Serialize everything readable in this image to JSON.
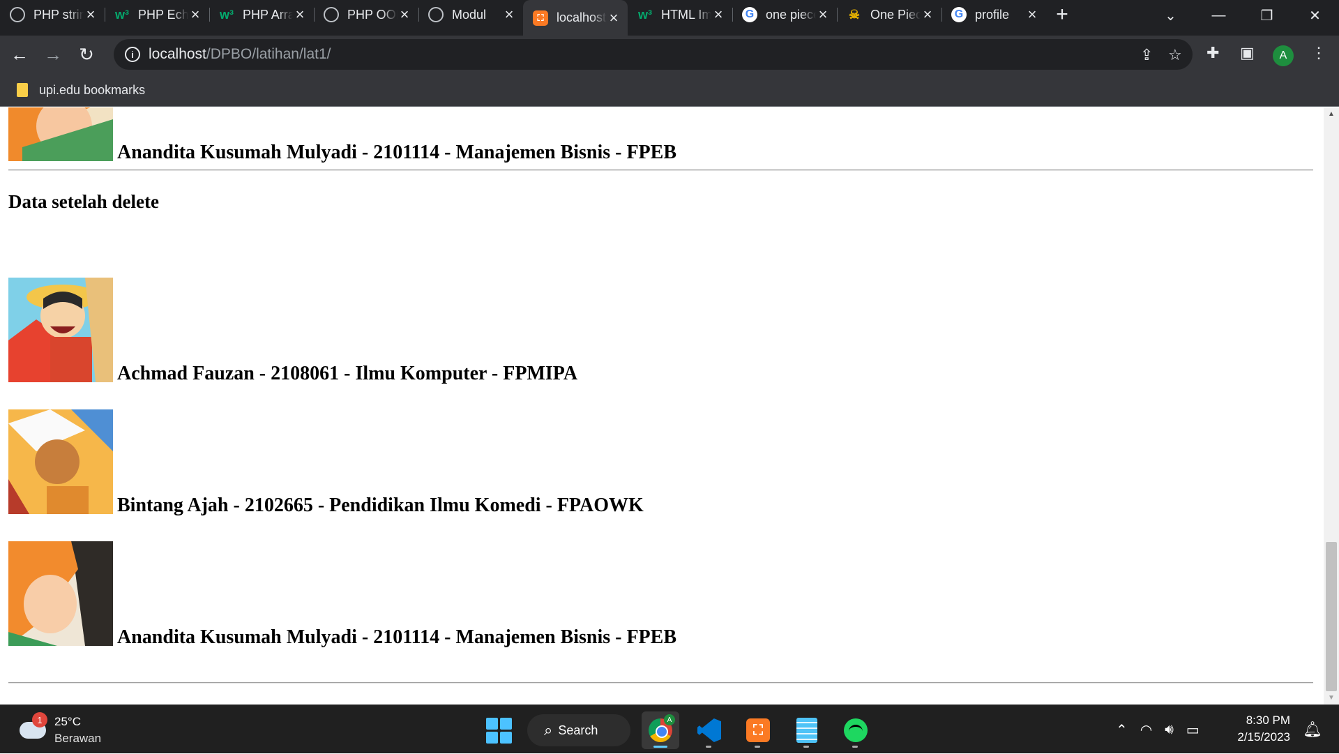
{
  "browser": {
    "tabs": [
      {
        "title": "PHP string",
        "favicon": "globe-icon",
        "active": false
      },
      {
        "title": "PHP Echo",
        "favicon": "w3schools-icon",
        "active": false
      },
      {
        "title": "PHP Arrays",
        "favicon": "w3schools-icon",
        "active": false
      },
      {
        "title": "PHP OOP",
        "favicon": "globe-icon",
        "active": false
      },
      {
        "title": "Modul",
        "favicon": "globe-icon",
        "active": false
      },
      {
        "title": "localhost",
        "favicon": "xampp-icon",
        "active": true
      },
      {
        "title": "HTML Images",
        "favicon": "w3schools-icon",
        "active": false
      },
      {
        "title": "one piece",
        "favicon": "google-icon",
        "active": false
      },
      {
        "title": "One Piece",
        "favicon": "onepiece-icon",
        "active": false
      },
      {
        "title": "profile",
        "favicon": "google-icon",
        "active": false
      }
    ],
    "address": {
      "host": "localhost",
      "path": "/DPBO/latihan/lat1/"
    },
    "profile_initial": "A",
    "bookmarks": [
      {
        "label": "upi.edu bookmarks"
      }
    ]
  },
  "page": {
    "top_row": {
      "caption": "Anandita Kusumah Mulyadi - 2101114 - Manajemen Bisnis - FPEB",
      "thumb": "nami-image"
    },
    "heading": "Data setelah delete",
    "rows": [
      {
        "caption": "Achmad Fauzan - 2108061 - Ilmu Komputer - FPMIPA",
        "thumb": "luffy-image"
      },
      {
        "caption": "Bintang Ajah - 2102665 - Pendidikan Ilmu Komedi - FPAOWK",
        "thumb": "usopp-image"
      },
      {
        "caption": "Anandita Kusumah Mulyadi - 2101114 - Manajemen Bisnis - FPEB",
        "thumb": "nami-image"
      }
    ]
  },
  "taskbar": {
    "weather": {
      "badge": "1",
      "temp": "25°C",
      "desc": "Berawan"
    },
    "search_label": "Search",
    "chrome_badge": "A",
    "clock": {
      "time": "8:30 PM",
      "date": "2/15/2023"
    }
  },
  "colors": {
    "accent": "#60cdff",
    "tab_bg": "#202124",
    "active_tab": "#35363a",
    "xampp": "#fb7a24"
  }
}
